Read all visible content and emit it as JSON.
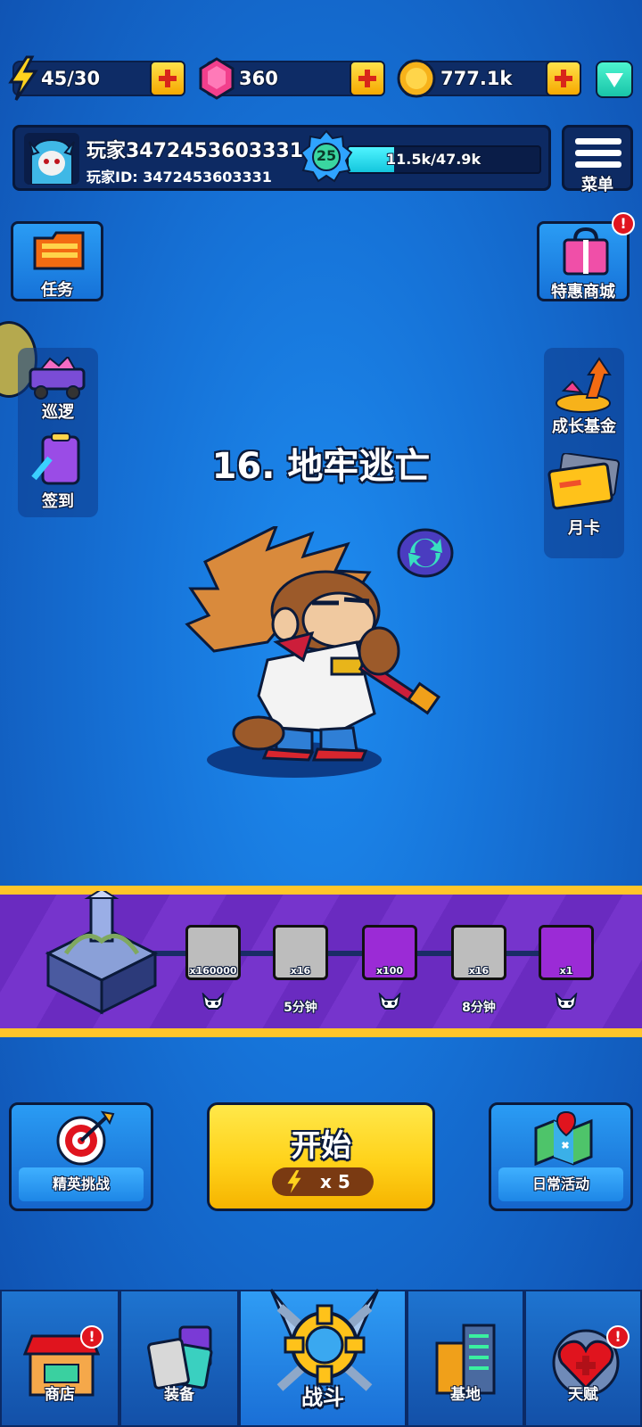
{
  "resources": {
    "energy": "45/30",
    "gems": "360",
    "coins": "777.1k"
  },
  "profile": {
    "name": "玩家3472453603331",
    "id_line": "玩家ID: 3472453603331",
    "level": "25",
    "xp": "11.5k/47.9k",
    "xp_fraction": 0.24,
    "menu_label": "菜单"
  },
  "left_buttons": {
    "tasks": "任务",
    "patrol": "巡逻",
    "checkin": "签到"
  },
  "right_buttons": {
    "shop_special": "特惠商城",
    "growth_fund": "成长基金",
    "monthly_card": "月卡"
  },
  "stage": {
    "title": "16. 地牢逃亡"
  },
  "rewards": [
    {
      "count": "x160000",
      "label": "",
      "color": "#bdbdbd"
    },
    {
      "count": "x16",
      "label": "5分钟",
      "color": "#bdbdbd"
    },
    {
      "count": "x100",
      "label": "",
      "color": "#9b2bd6"
    },
    {
      "count": "x16",
      "label": "8分钟",
      "color": "#bdbdbd"
    },
    {
      "count": "x1",
      "label": "",
      "color": "#9b2bd6"
    }
  ],
  "actions": {
    "elite": "精英挑战",
    "start": "开始",
    "start_cost": "x 5",
    "daily": "日常活动"
  },
  "nav": {
    "shop": "商店",
    "equipment": "装备",
    "battle": "战斗",
    "base": "基地",
    "talent": "天赋"
  },
  "badge_mark": "!"
}
